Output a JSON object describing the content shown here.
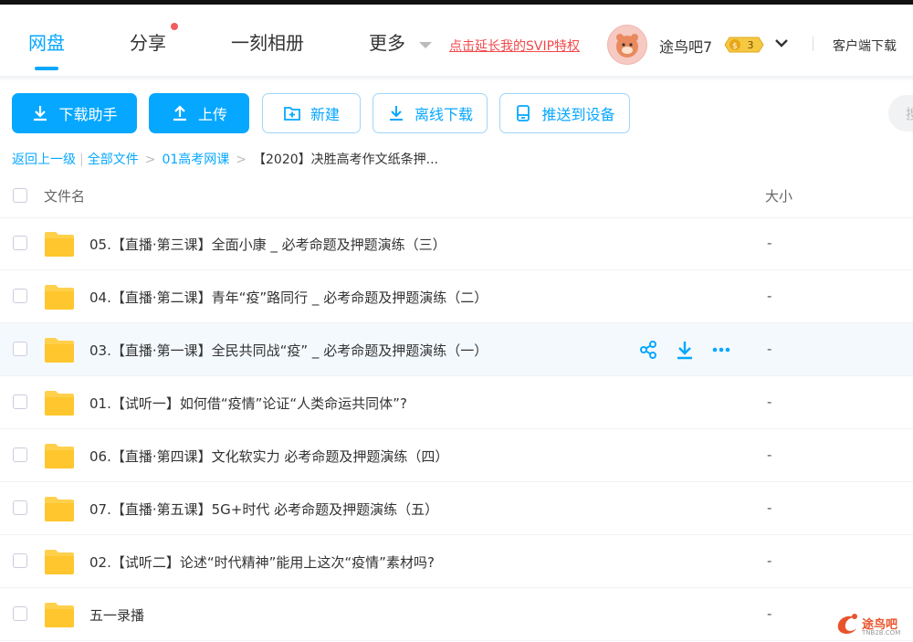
{
  "nav": {
    "tabs": [
      {
        "label": "网盘",
        "active": true
      },
      {
        "label": "分享",
        "has_dot": true
      },
      {
        "label": "一刻相册"
      },
      {
        "label": "更多"
      }
    ],
    "svip_link": "点击延长我的SVIP特权",
    "username": "途鸟吧7",
    "badge_level": "3",
    "client_download": "客户端下载"
  },
  "toolbar": {
    "download_helper": "下载助手",
    "upload": "上传",
    "new": "新建",
    "offline_download": "离线下载",
    "push_to_device": "推送到设备",
    "search_stub": "搜"
  },
  "breadcrumb": {
    "back": "返回上一级",
    "all_files": "全部文件",
    "folder": "01高考网课",
    "current": "【2020】决胜高考作文纸条押..."
  },
  "file_list": {
    "header": {
      "name": "文件名",
      "size": "大小"
    },
    "rows": [
      {
        "name": "05.【直播·第三课】全面小康 _ 必考命题及押题演练（三）",
        "size": "-"
      },
      {
        "name": "04.【直播·第二课】青年“疫”路同行 _ 必考命题及押题演练（二）",
        "size": "-"
      },
      {
        "name": "03.【直播·第一课】全民共同战“疫” _ 必考命题及押题演练（一）",
        "size": "-"
      },
      {
        "name": "01.【试听一】如何借“疫情”论证“人类命运共同体”?",
        "size": "-"
      },
      {
        "name": "06.【直播·第四课】文化软实力 必考命题及押题演练（四）",
        "size": "-"
      },
      {
        "name": "07.【直播·第五课】5G+时代 必考命题及押题演练（五）",
        "size": "-"
      },
      {
        "name": "02.【试听二】论述“时代精神”能用上这次“疫情”素材吗?",
        "size": "-"
      },
      {
        "name": "五一录播",
        "size": "-"
      }
    ]
  },
  "watermark": {
    "text": "途鸟吧",
    "sub": "TNB2B.COM"
  },
  "colors": {
    "accent": "#06a7ff",
    "svip_red": "#f2494b",
    "folder": "#ffd04b",
    "badge": "#f5c842"
  }
}
